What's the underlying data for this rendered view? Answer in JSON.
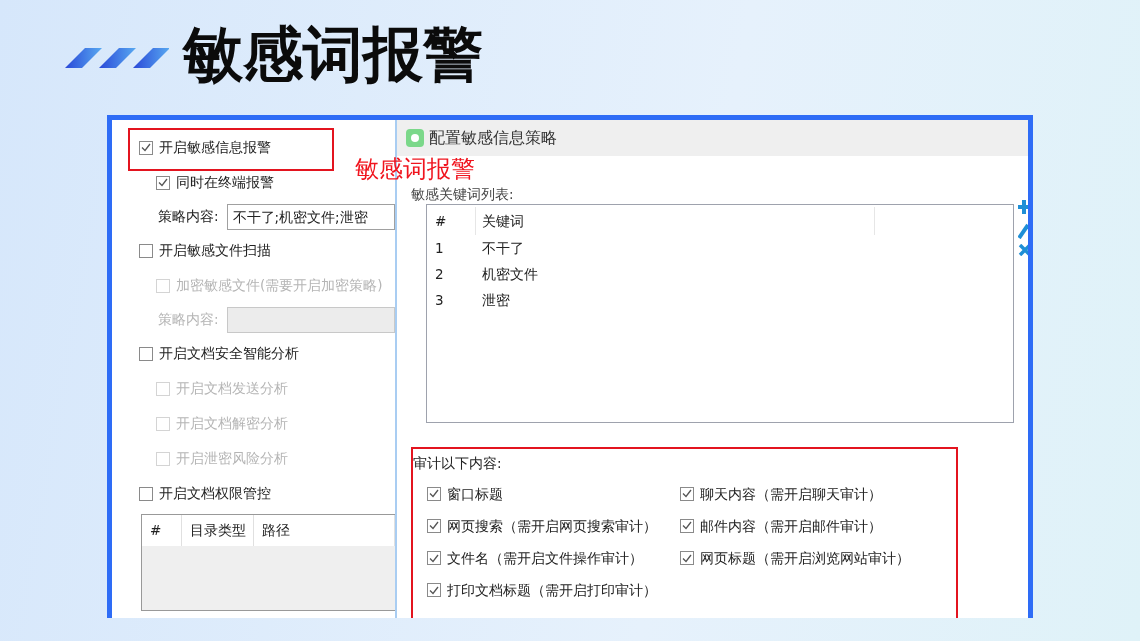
{
  "slide": {
    "title": "敏感词报警"
  },
  "annotation": {
    "label": "敏感词报警"
  },
  "settings": [
    {
      "kind": "checkbox",
      "label": "开启敏感信息报警",
      "checked": true,
      "disabled": false,
      "annotated": true,
      "children": [
        {
          "kind": "checkbox",
          "label": "同时在终端报警",
          "checked": true,
          "disabled": false
        },
        {
          "kind": "field",
          "label": "策略内容:",
          "value": "不干了;机密文件;泄密",
          "disabled": false
        }
      ]
    },
    {
      "kind": "checkbox",
      "label": "开启敏感文件扫描",
      "checked": false,
      "disabled": false,
      "children": [
        {
          "kind": "checkbox",
          "label": "加密敏感文件(需要开启加密策略)",
          "checked": false,
          "disabled": true
        },
        {
          "kind": "field",
          "label": "策略内容:",
          "disabled": true
        }
      ]
    },
    {
      "kind": "checkbox",
      "label": "开启文档安全智能分析",
      "checked": false,
      "disabled": false,
      "children": [
        {
          "kind": "checkbox",
          "label": "开启文档发送分析",
          "checked": false,
          "disabled": true
        },
        {
          "kind": "checkbox",
          "label": "开启文档解密分析",
          "checked": false,
          "disabled": true
        },
        {
          "kind": "checkbox",
          "label": "开启泄密风险分析",
          "checked": false,
          "disabled": true
        }
      ]
    },
    {
      "kind": "checkbox",
      "label": "开启文档权限管控",
      "checked": false,
      "disabled": false,
      "children": [
        {
          "kind": "table",
          "columns": [
            "#",
            "目录类型",
            "路径"
          ]
        }
      ]
    }
  ],
  "dialog": {
    "title": "配置敏感信息策略",
    "keyword_list": {
      "label": "敏感关键词列表:",
      "columns": [
        "#",
        "关键词"
      ],
      "rows": [
        [
          "1",
          "不干了"
        ],
        [
          "2",
          "机密文件"
        ],
        [
          "3",
          "泄密"
        ]
      ]
    },
    "audit": {
      "label": "审计以下内容:",
      "annotated": true,
      "options": [
        {
          "label": "窗口标题",
          "checked": true
        },
        {
          "label": "聊天内容（需开启聊天审计）",
          "checked": true
        },
        {
          "label": "网页搜索（需开启网页搜索审计）",
          "checked": true
        },
        {
          "label": "邮件内容（需开启邮件审计）",
          "checked": true
        },
        {
          "label": "文件名（需开启文件操作审计）",
          "checked": true
        },
        {
          "label": "网页标题（需开启浏览网站审计）",
          "checked": true
        },
        {
          "label": "打印文档标题（需开启打印审计）",
          "checked": true
        }
      ]
    }
  }
}
